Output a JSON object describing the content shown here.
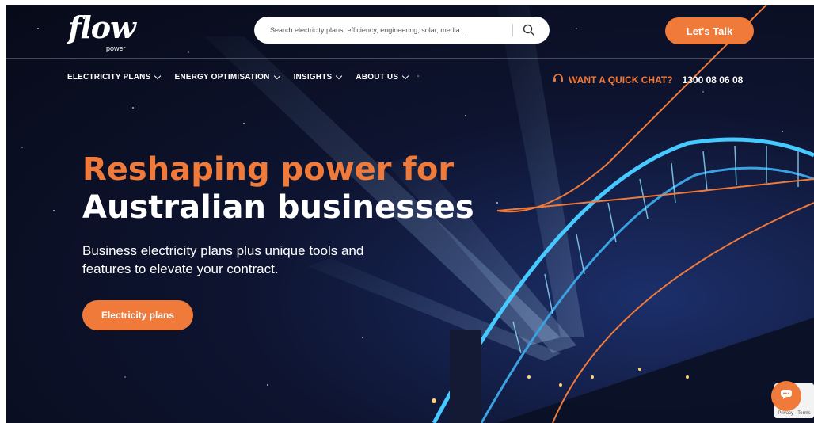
{
  "header": {
    "logo_text": "flow",
    "logo_sub": "power",
    "search_placeholder": "Search electricity plans, efficiency, engineering, solar, media...",
    "cta_label": "Let's Talk"
  },
  "nav": {
    "items": [
      {
        "label": "ELECTRICITY PLANS"
      },
      {
        "label": "ENERGY OPTIMISATION"
      },
      {
        "label": "INSIGHTS"
      },
      {
        "label": "ABOUT US"
      }
    ],
    "chat_label": "WANT A QUICK CHAT?",
    "phone": "1300 08 06 08"
  },
  "hero": {
    "title_line1": "Reshaping power for",
    "title_line2": "Australian businesses",
    "subtitle": "Business electricity plans plus unique tools and features to elevate your contract.",
    "button_label": "Electricity plans"
  },
  "widgets": {
    "recaptcha_text": "Privacy - Terms"
  },
  "colors": {
    "accent": "#f07a3a",
    "background": "#0e1430"
  },
  "icons": [
    "search-icon",
    "chevron-down-icon",
    "headset-icon",
    "chat-bubble-icon"
  ]
}
